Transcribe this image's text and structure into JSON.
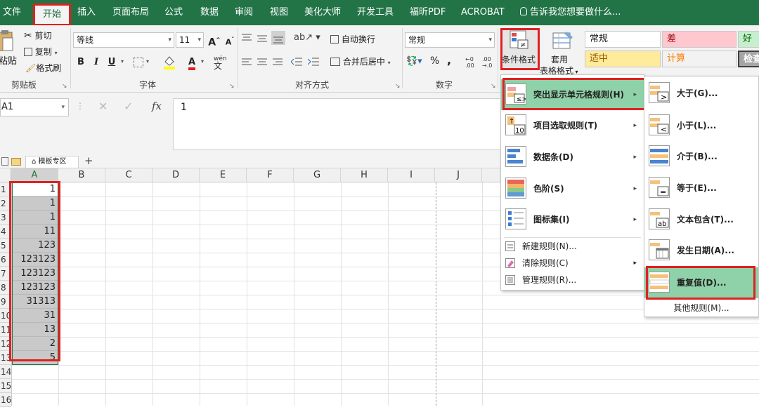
{
  "menu_tabs": [
    "文件",
    "开始",
    "插入",
    "页面布局",
    "公式",
    "数据",
    "审阅",
    "视图",
    "美化大师",
    "开发工具",
    "福昕PDF",
    "ACROBAT",
    "告诉我您想要做什么..."
  ],
  "clipboard": {
    "paste": "粘贴",
    "cut": "剪切",
    "copy": "复制",
    "format_painter": "格式刷",
    "label": "剪贴板"
  },
  "font": {
    "name": "等线",
    "size": "11",
    "label": "字体",
    "bold": "B",
    "italic": "I",
    "underline": "U",
    "grow": "A",
    "shrink": "A",
    "font_color": "A",
    "phonetic": "wén"
  },
  "alignment": {
    "wrap": "自动换行",
    "merge": "合并后居中",
    "label": "对齐方式"
  },
  "number": {
    "format": "常规",
    "percent": "%",
    "comma": ",",
    "label": "数字"
  },
  "styles": {
    "conditional_format": "条件格式",
    "table_format_1": "套用",
    "table_format_2": "表格格式",
    "cells": [
      {
        "text": "常规",
        "bg": "#ffffff",
        "color": "#222222"
      },
      {
        "text": "差",
        "bg": "#ffc7ce",
        "color": "#9c0006"
      },
      {
        "text": "好",
        "bg": "#c6efce",
        "color": "#006100"
      },
      {
        "text": "适中",
        "bg": "#ffeb9c",
        "color": "#9c5700"
      },
      {
        "text": "计算",
        "bg": "#f2f2f2",
        "color": "#fa7d00"
      },
      {
        "text": "检查",
        "bg": "#a5a5a5",
        "color": "#ffffff"
      }
    ]
  },
  "formula_bar": {
    "name_box": "A1",
    "fx": "fx",
    "value": "1"
  },
  "sheet_tabs": {
    "template": "模板专区",
    "add": "+"
  },
  "columns": [
    "A",
    "B",
    "C",
    "D",
    "E",
    "F",
    "G",
    "H",
    "I",
    "J"
  ],
  "rows": [
    "1",
    "2",
    "3",
    "4",
    "5",
    "6",
    "7",
    "8",
    "9",
    "10",
    "11",
    "12",
    "13",
    "14",
    "15",
    "16"
  ],
  "column_a_values": [
    "1",
    "1",
    "1",
    "11",
    "123",
    "123123",
    "123123",
    "123123",
    "31313",
    "31",
    "13",
    "2",
    "5"
  ],
  "cf_menu": {
    "items": [
      {
        "label": "突出显示单元格规则(H)",
        "icon": "highlight-rules-icon",
        "arrow": "▸"
      },
      {
        "label": "项目选取规则(T)",
        "icon": "top-bottom-rules-icon",
        "arrow": "▸"
      },
      {
        "label": "数据条(D)",
        "icon": "data-bars-icon",
        "arrow": "▸"
      },
      {
        "label": "色阶(S)",
        "icon": "color-scales-icon",
        "arrow": "▸"
      },
      {
        "label": "图标集(I)",
        "icon": "icon-sets-icon",
        "arrow": "▸"
      }
    ],
    "small_items": [
      {
        "label": "新建规则(N)...",
        "icon": "new-rule-icon"
      },
      {
        "label": "清除规则(C)",
        "icon": "clear-rules-icon",
        "arrow": "▸"
      },
      {
        "label": "管理规则(R)...",
        "icon": "manage-rules-icon"
      }
    ]
  },
  "highlight_submenu": {
    "items": [
      {
        "label": "大于(G)...",
        "glyph": ">"
      },
      {
        "label": "小于(L)...",
        "glyph": "<"
      },
      {
        "label": "介于(B)...",
        "glyph": ""
      },
      {
        "label": "等于(E)...",
        "glyph": "="
      },
      {
        "label": "文本包含(T)...",
        "glyph": "ab"
      },
      {
        "label": "发生日期(A)...",
        "glyph": ""
      },
      {
        "label": "重复值(D)...",
        "glyph": ""
      }
    ],
    "more": "其他规则(M)..."
  },
  "colors": {
    "excel_green": "#227447",
    "menu_highlight": "#8fd1a8",
    "annotation_red": "#e02020",
    "selection_gray": "#c9c9c9"
  }
}
